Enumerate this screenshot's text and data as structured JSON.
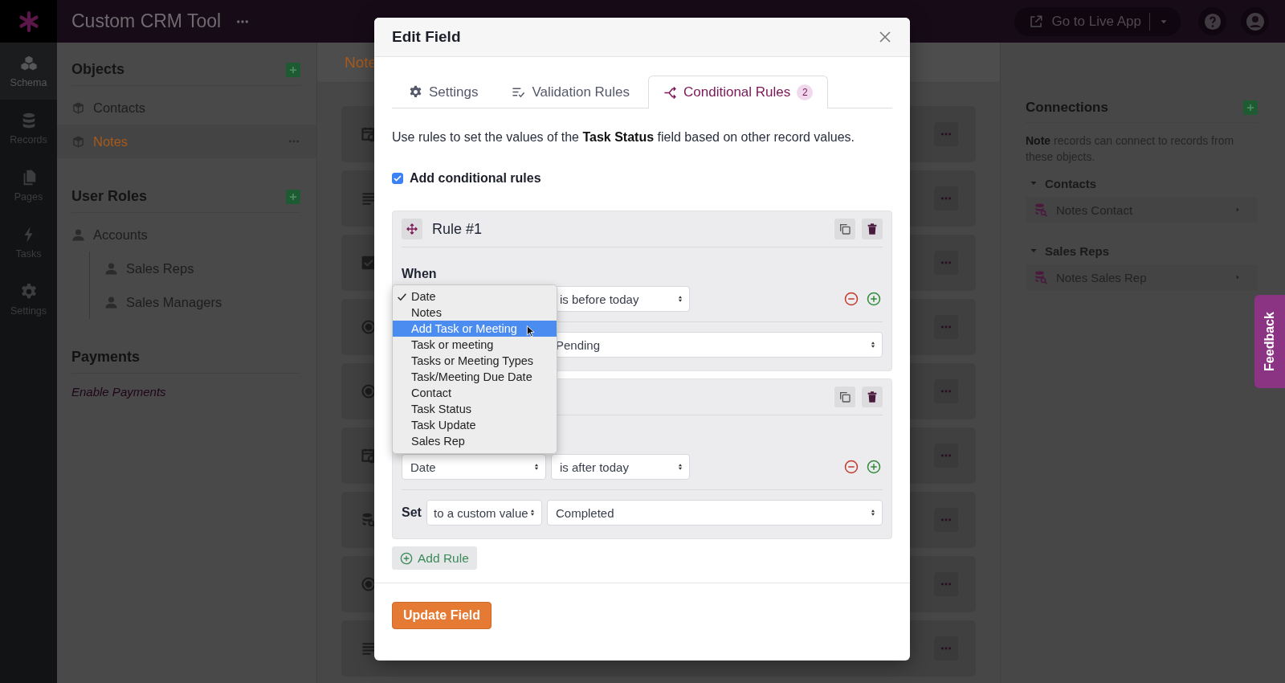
{
  "top_bar": {
    "app_title": "Custom CRM Tool",
    "live_app_button": "Go to Live App"
  },
  "nav": [
    {
      "kind": "schema",
      "label": "Schema",
      "selected": true
    },
    {
      "kind": "records",
      "label": "Records",
      "selected": false
    },
    {
      "kind": "pages",
      "label": "Pages",
      "selected": false
    },
    {
      "kind": "tasks",
      "label": "Tasks",
      "selected": false
    },
    {
      "kind": "settings",
      "label": "Settings",
      "selected": false
    }
  ],
  "sidebar": {
    "sections": [
      {
        "kind": "objects",
        "title": "Objects",
        "items": [
          {
            "label": "Contacts",
            "selected": false
          },
          {
            "label": "Notes",
            "selected": true
          }
        ]
      },
      {
        "kind": "roles",
        "title": "User Roles",
        "items": [
          {
            "label": "Accounts",
            "selected": false,
            "children": [
              {
                "label": "Sales Reps",
                "selected": false
              },
              {
                "label": "Sales Managers",
                "selected": false
              }
            ]
          }
        ]
      },
      {
        "kind": "payments",
        "title": "Payments",
        "link": "Enable Payments"
      }
    ]
  },
  "content": {
    "tab": "Note",
    "fields": [
      {
        "kind": "date"
      },
      {
        "kind": "paragraph"
      },
      {
        "kind": "checkbox"
      },
      {
        "kind": "choice"
      },
      {
        "kind": "choice"
      },
      {
        "kind": "date"
      },
      {
        "kind": "connection"
      },
      {
        "kind": "choice"
      },
      {
        "kind": "paragraph"
      }
    ]
  },
  "connections": {
    "title": "Connections",
    "description": "**Note** records can connect to records from these objects.",
    "groups": [
      {
        "name": "Contacts",
        "items": [
          "Notes Contact"
        ]
      },
      {
        "name": "Sales Reps",
        "items": [
          "Notes Sales Rep"
        ]
      }
    ]
  },
  "feedback": "Feedback",
  "modal": {
    "title": "Edit Field",
    "tabs": [
      {
        "kind": "settings",
        "label": "Settings",
        "selected": false
      },
      {
        "kind": "validation",
        "label": "Validation Rules",
        "selected": false
      },
      {
        "kind": "conditional",
        "label": "Conditional Rules",
        "badge": "2",
        "selected": true
      }
    ],
    "description": "Use rules to set the values of the **Task Status** field based on other record values.",
    "enable": {
      "label": "Add conditional rules",
      "checked": true
    },
    "rules": [
      {
        "title": "Rule #1",
        "when_label": "When",
        "conditions": [
          {
            "operator": "is before today"
          }
        ],
        "set": {
          "value": "Pending"
        }
      },
      {
        "conditions": [
          {
            "field": "Date",
            "operator": "is after today"
          }
        ],
        "set": {
          "label": "Set",
          "mode": "to a custom value",
          "value": "Completed"
        }
      }
    ],
    "add_rule": "Add Rule",
    "submit": "Update Field"
  },
  "dropdown": {
    "options": [
      {
        "label": "Date",
        "selected": true,
        "highlighted": false
      },
      {
        "label": "Notes",
        "selected": false,
        "highlighted": false
      },
      {
        "label": "Add Task or Meeting",
        "selected": false,
        "highlighted": true
      },
      {
        "label": "Task or meeting",
        "selected": false,
        "highlighted": false
      },
      {
        "label": "Tasks or Meeting Types",
        "selected": false,
        "highlighted": false
      },
      {
        "label": "Task/Meeting Due Date",
        "selected": false,
        "highlighted": false
      },
      {
        "label": "Contact",
        "selected": false,
        "highlighted": false
      },
      {
        "label": "Task Status",
        "selected": false,
        "highlighted": false
      },
      {
        "label": "Task Update",
        "selected": false,
        "highlighted": false
      },
      {
        "label": "Sales Rep",
        "selected": false,
        "highlighted": false
      }
    ]
  }
}
